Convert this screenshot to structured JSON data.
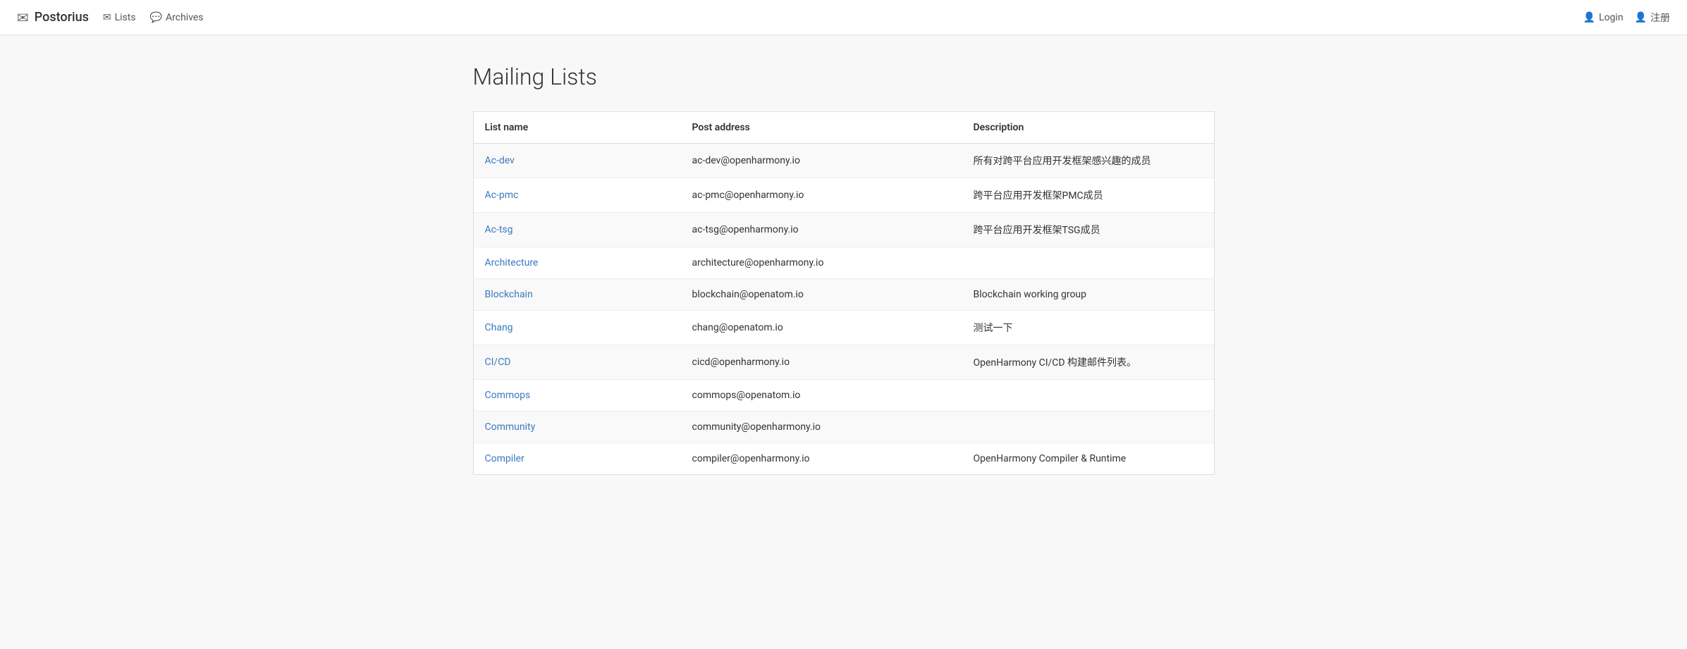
{
  "brand": {
    "icon": "✉",
    "label": "Postorius"
  },
  "nav": {
    "lists_label": "Lists",
    "archives_label": "Archives",
    "lists_icon": "✉",
    "archives_icon": "💬"
  },
  "auth": {
    "login_label": "Login",
    "register_label": "注册",
    "login_icon": "👤",
    "register_icon": "👤"
  },
  "page": {
    "title": "Mailing Lists"
  },
  "table": {
    "col_name": "List name",
    "col_post": "Post address",
    "col_desc": "Description"
  },
  "rows": [
    {
      "name": "Ac-dev",
      "post": "ac-dev@openharmony.io",
      "desc": "所有对跨平台应用开发框架感兴趣的成员"
    },
    {
      "name": "Ac-pmc",
      "post": "ac-pmc@openharmony.io",
      "desc": "跨平台应用开发框架PMC成员"
    },
    {
      "name": "Ac-tsg",
      "post": "ac-tsg@openharmony.io",
      "desc": "跨平台应用开发框架TSG成员"
    },
    {
      "name": "Architecture",
      "post": "architecture@openharmony.io",
      "desc": ""
    },
    {
      "name": "Blockchain",
      "post": "blockchain@openatom.io",
      "desc": "Blockchain working group"
    },
    {
      "name": "Chang",
      "post": "chang@openatom.io",
      "desc": "测试一下"
    },
    {
      "name": "CI/CD",
      "post": "cicd@openharmony.io",
      "desc": "OpenHarmony CI/CD 构建邮件列表。"
    },
    {
      "name": "Commops",
      "post": "commops@openatom.io",
      "desc": ""
    },
    {
      "name": "Community",
      "post": "community@openharmony.io",
      "desc": ""
    },
    {
      "name": "Compiler",
      "post": "compiler@openharmony.io",
      "desc": "OpenHarmony Compiler & Runtime"
    }
  ]
}
